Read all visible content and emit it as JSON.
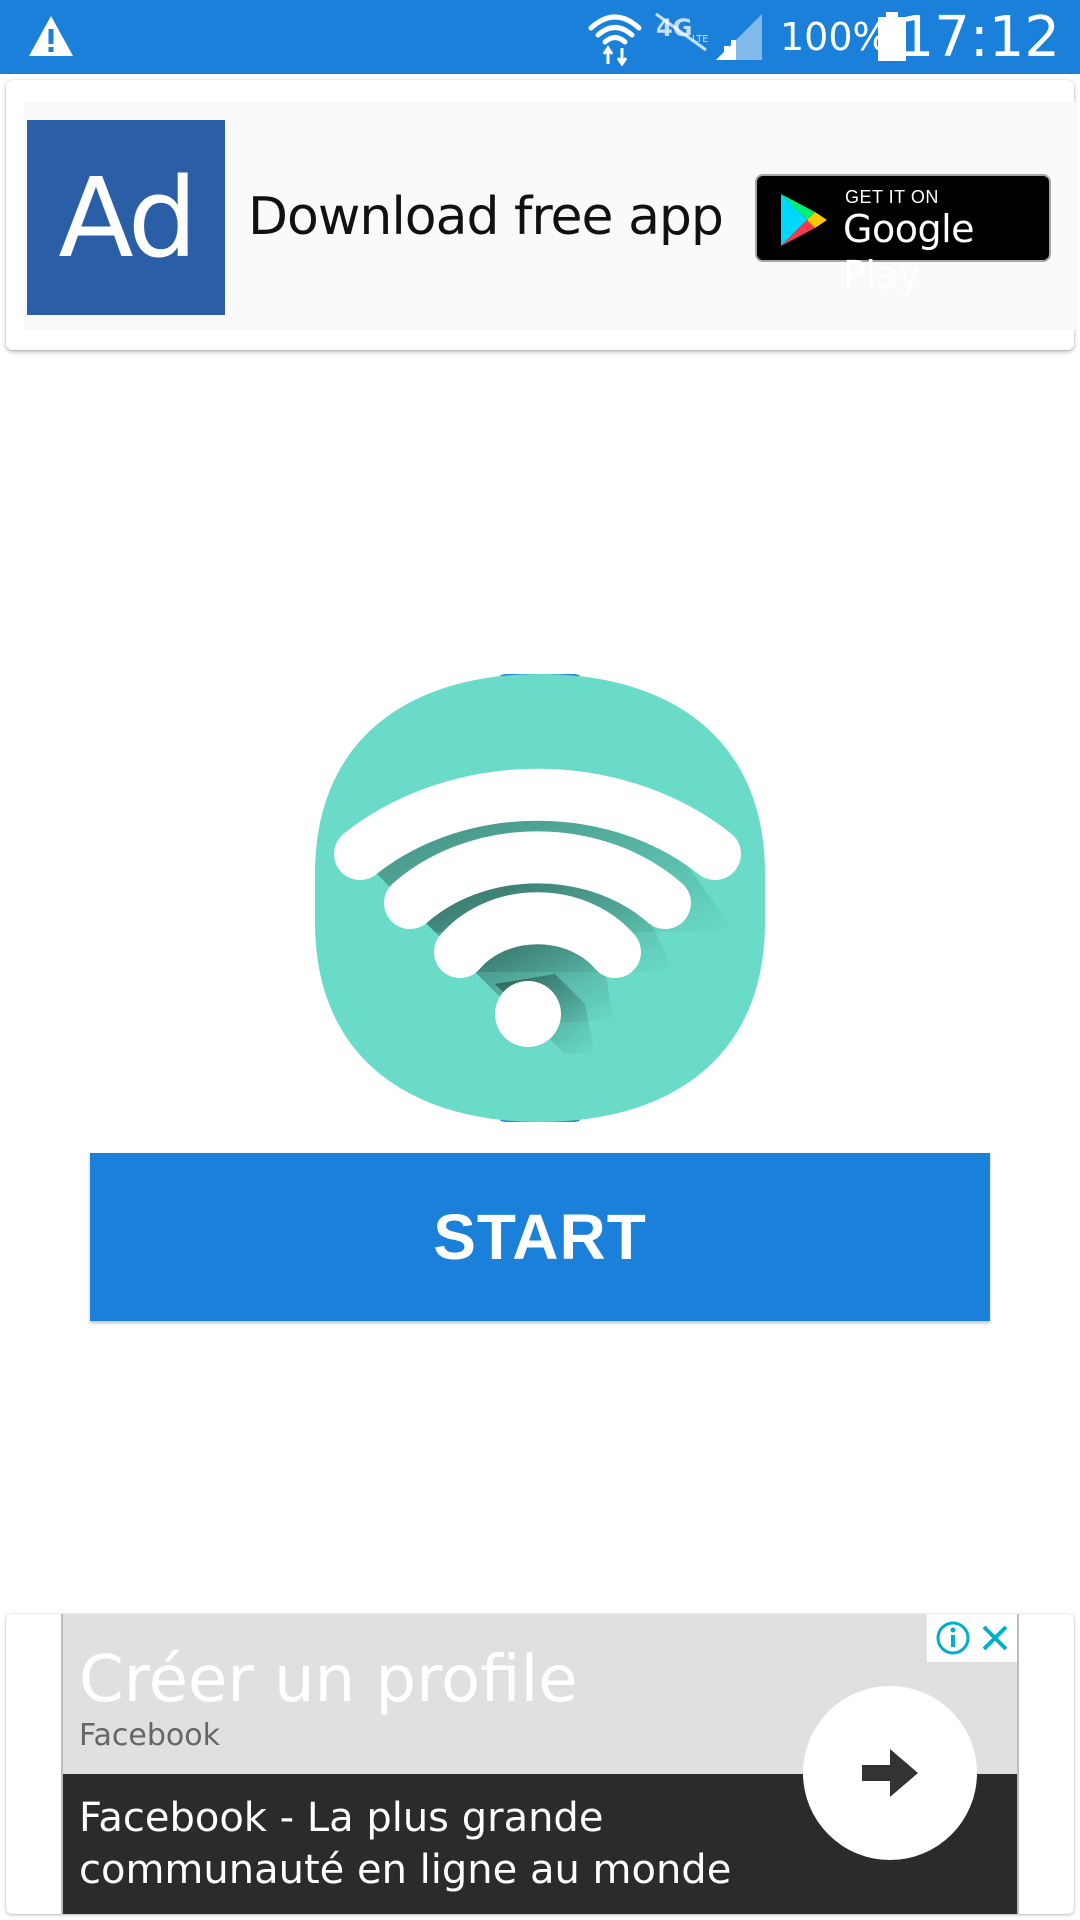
{
  "status_bar": {
    "battery_percent": "100%",
    "time": "17:12",
    "icons": [
      "warning-icon",
      "wifi-icon",
      "4g-off-icon",
      "signal-icon",
      "battery-icon"
    ]
  },
  "top_ad": {
    "logo_text": "Ad",
    "headline": "Download free app",
    "badge_line1": "GET IT ON",
    "badge_line2": "Google Play"
  },
  "main": {
    "illustration_icon": "wifi-icon",
    "start_label": "START"
  },
  "bottom_ad": {
    "title": "Créer un profile",
    "source": "Facebook",
    "body_line1": "Facebook - La plus grande",
    "body_line2": "communauté en ligne au monde",
    "cta_icon": "arrow-right-icon"
  },
  "colors": {
    "primary": "#1a80d9",
    "teal": "#6adbc8",
    "ad_logo": "#2a5fa8",
    "ad_dark": "#2b2b2b",
    "ad_light": "#e0e0e0",
    "ad_choices": "#00aecd"
  }
}
